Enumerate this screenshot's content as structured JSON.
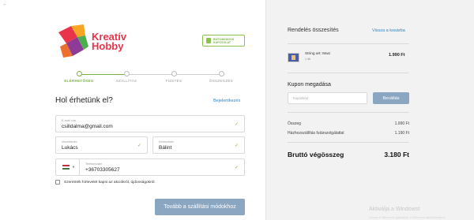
{
  "nav": {
    "back_arrow": "←"
  },
  "brand": {
    "line1": "Kreatív",
    "line2": "Hobby"
  },
  "secure_badge": {
    "line1": "BIZTONSÁGOS",
    "line2": "KAPCSOLAT"
  },
  "steps": [
    {
      "label": "ELÉRHETŐSÉG",
      "active": true
    },
    {
      "label": "SZÁLLÍTÁS",
      "active": false
    },
    {
      "label": "FIZETÉS",
      "active": false
    },
    {
      "label": "ÖSSZEGZÉS",
      "active": false
    }
  ],
  "contact": {
    "heading": "Hol érhetünk el?",
    "login_link": "Bejelentkezés",
    "email": {
      "label": "E-mail cím",
      "value": "csilldalma@gmail.com"
    },
    "last_name": {
      "label": "Vezetéknév",
      "value": "Lukács"
    },
    "first_name": {
      "label": "Keresztnév",
      "value": "Bálint"
    },
    "phone": {
      "label": "Telefonszám",
      "value": "+36703305627"
    },
    "check_mark": "✓",
    "dropdown_glyph": "▼",
    "newsletter_label": "Szeretnék hírlevelet kapni az akciókról, újdonságokról.",
    "next_button": "Tovább a szállítási módokhoz"
  },
  "summary": {
    "title": "Rendelés összesítés",
    "back_to_cart": "Vissza a kosárba",
    "product": {
      "name": "String art: Maci",
      "qty": "1 db",
      "price": "1.990 Ft"
    },
    "coupon_title": "Kupon megadása",
    "coupon_placeholder": "Kuponkód",
    "coupon_button": "Beváltás",
    "rows": [
      {
        "label": "Összeg",
        "value": "1.990 Ft"
      },
      {
        "label": "Házhozszállítás futárszolgálattal",
        "value": "1.190 Ft"
      }
    ],
    "total": {
      "label": "Bruttó végösszeg",
      "value": "3.180 Ft"
    }
  },
  "watermark": {
    "line1": "Aktiválja a Windowst",
    "line2": "Nyissa a Windows-gépházat a Windows aktiválásához."
  },
  "colors": {
    "accent_green": "#7cb342",
    "link_blue": "#2e86c1",
    "button_blue": "#8aa6c1",
    "brand_red": "#e8334a"
  }
}
